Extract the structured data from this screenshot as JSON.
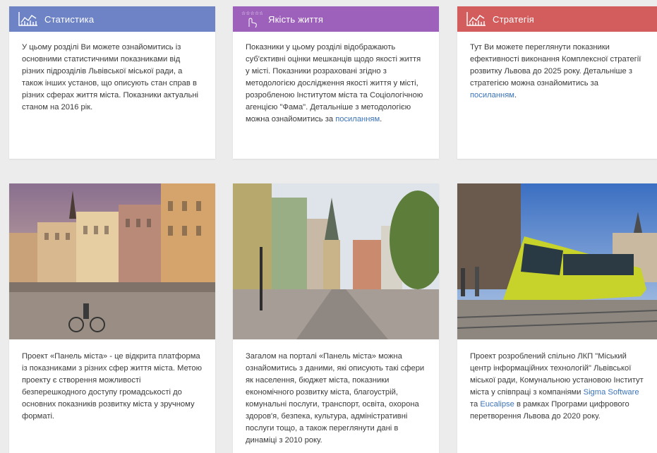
{
  "colors": {
    "stats": "#6d83c6",
    "quality": "#9d61bc",
    "strategy": "#d35d5d",
    "link": "#3b73b9"
  },
  "cards_top": [
    {
      "title": "Статистика",
      "icon": "chart-line-icon",
      "text": "У цьому розділі Ви можете ознайомитись із основними статистичними показниками від різних підрозділів Львівської міської ради, а також інших установ, що описують стан справ в різних сферах життя міста. Показники актуальні станом на 2016 рік."
    },
    {
      "title": "Якість життя",
      "icon": "stars-hand-icon",
      "text_before": "Показники у цьому розділі відображають суб'єктивні оцінки мешканців щодо якості життя у місті. Показники розраховані згідно з методологією дослідження якості життя у місті, розробленою Інститутом міста та Соціологічною агенцією \"Фама\". Детальніше з методологією можна ознайомитись за ",
      "link": "посиланням",
      "text_after": "."
    },
    {
      "title": "Стратегія",
      "icon": "chart-line-icon",
      "text_before": "Тут Ви можете переглянути показники ефективності виконання Комплексної стратегії розвитку Львова до 2025 року. Детальніше з стратегією можна ознайомитись за ",
      "link": "посиланням",
      "text_after": "."
    }
  ],
  "cards_bottom": [
    {
      "photo": "market-square-photo",
      "text": "Проект «Панель міста» - це відкрита платформа із показниками з різних сфер життя міста. Метою проекту є створення можливості безперешкодного доступу громадськості до основних показників розвитку міста у зручному форматі."
    },
    {
      "photo": "street-church-photo",
      "text": "Загалом на порталі «Панель міста» можна ознайомитись з даними, які описують такі сфери як населення, бюджет міста, показники економічного розвитку міста, благоустрій, комунальні послуги, транспорт, освіта, охорона здоров'я, безпека, культура, адміністративні послуги тощо, а також переглянути дані в динаміці з 2010 року."
    },
    {
      "photo": "tram-photo",
      "text_before": "Проект розроблений спільно ЛКП \"Міський центр інформаційних технологій\" Львівської міської ради, Комунальною установою Інститут міста у співпраці з компаніями ",
      "link1": "Sigma Software",
      "text_mid": " та ",
      "link2": "Eucalipse",
      "text_after": " в рамках Програми цифрового перетворення Львова до 2020 року."
    }
  ]
}
